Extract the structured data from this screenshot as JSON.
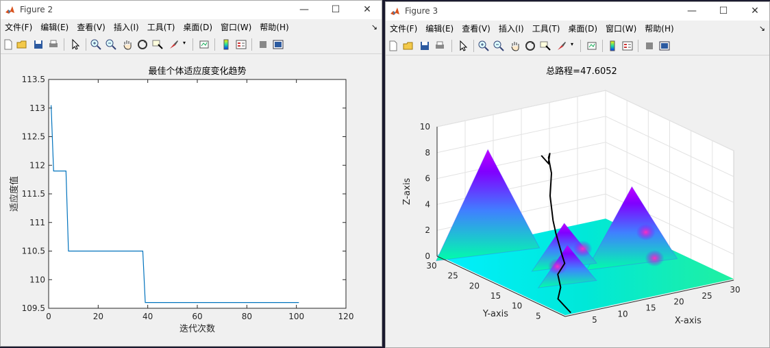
{
  "fig2": {
    "title": "Figure 2",
    "menus": [
      "文件(F)",
      "编辑(E)",
      "查看(V)",
      "插入(I)",
      "工具(T)",
      "桌面(D)",
      "窗口(W)",
      "帮助(H)"
    ],
    "chart_data": {
      "type": "line",
      "title": "最佳个体适应度变化趋势",
      "xlabel": "迭代次数",
      "ylabel": "适应度值",
      "xlim": [
        0,
        120
      ],
      "ylim": [
        109.5,
        113.5
      ],
      "xticks": [
        0,
        20,
        40,
        60,
        80,
        100,
        120
      ],
      "yticks": [
        109.5,
        110,
        110.5,
        111,
        111.5,
        112,
        112.5,
        113,
        113.5
      ],
      "series": [
        {
          "color": "#0072bd",
          "x": [
            1,
            2,
            3,
            7,
            8,
            38,
            39,
            101
          ],
          "y": [
            113.05,
            111.9,
            111.9,
            111.9,
            110.5,
            110.5,
            109.6,
            109.6
          ]
        }
      ]
    }
  },
  "fig3": {
    "title": "Figure 3",
    "menus": [
      "文件(F)",
      "编辑(E)",
      "查看(V)",
      "插入(I)",
      "工具(T)",
      "桌面(D)",
      "窗口(W)",
      "帮助(H)"
    ],
    "chart_data": {
      "type": "surface",
      "title": "总路程=47.6052",
      "xlabel": "X-axis",
      "ylabel": "Y-axis",
      "zlabel": "Z-axis",
      "xlim": [
        0,
        30
      ],
      "ylim": [
        0,
        30
      ],
      "zlim": [
        0,
        10
      ],
      "xticks": [
        5,
        10,
        15,
        20,
        25,
        30
      ],
      "yticks": [
        5,
        10,
        15,
        20,
        25,
        30
      ],
      "zticks": [
        0,
        2,
        4,
        6,
        8,
        10
      ],
      "path_color": "#000000"
    }
  }
}
